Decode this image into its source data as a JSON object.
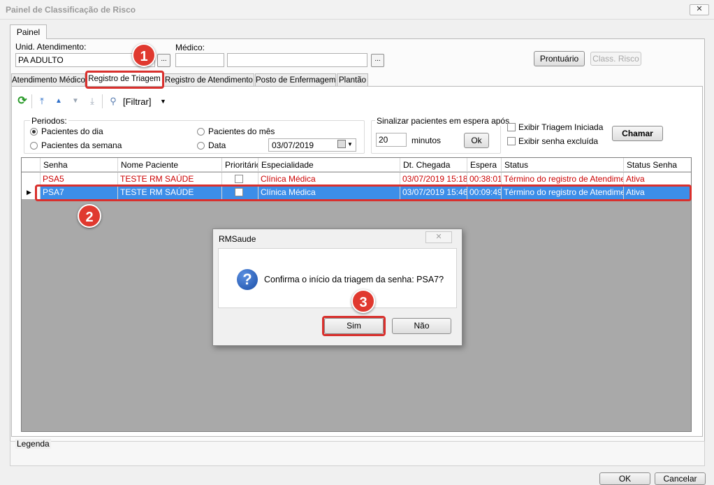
{
  "window": {
    "title": "Painel de Classificação de Risco",
    "close_glyph": "✕"
  },
  "top_tab": {
    "label": "Painel"
  },
  "form": {
    "unid_label": "Unid. Atendimento:",
    "unid_value": "PA ADULTO",
    "medico_label": "Médico:",
    "medico_code": "",
    "medico_name": "",
    "lookup_glyph": "..."
  },
  "buttons": {
    "prontuario": "Prontuário",
    "class_risco": "Class. Risco",
    "chamar": "Chamar",
    "ok_small": "Ok"
  },
  "subtabs": [
    {
      "label": "Atendimento Médico"
    },
    {
      "label": "Registro de Triagem"
    },
    {
      "label": "Registro de Atendimento"
    },
    {
      "label": "Posto de Enfermagem"
    },
    {
      "label": "Plantão"
    }
  ],
  "toolbar": {
    "filter_label": "[Filtrar]"
  },
  "periods": {
    "label": "Periodos:",
    "options": [
      "Pacientes do dia",
      "Pacientes da semana",
      "Pacientes do mês",
      "Data"
    ],
    "selected": "Pacientes do dia",
    "date_value": "03/07/2019"
  },
  "signal": {
    "label": "Sinalizar pacientes em espera após",
    "minutes_value": "20",
    "minutes_label": "minutos"
  },
  "checks": {
    "triagem_iniciada": "Exibir Triagem Iniciada",
    "senha_excluida": "Exibir senha excluída"
  },
  "grid": {
    "columns": [
      "Senha",
      "Nome Paciente",
      "Prioritário",
      "Especialidade",
      "Dt. Chegada",
      "Espera",
      "Status",
      "Status Senha"
    ],
    "rows": [
      {
        "senha": "PSA5",
        "nome": "TESTE RM SAÚDE",
        "especialidade": "Clínica Médica",
        "chegada": "03/07/2019 15:18",
        "espera": "00:38:01",
        "status": "Término do registro de Atendimento",
        "status_senha": "Ativa"
      },
      {
        "senha": "PSA7",
        "nome": "TESTE RM SAÚDE",
        "especialidade": "Clínica Médica",
        "chegada": "03/07/2019 15:46",
        "espera": "00:09:49",
        "status": "Término do registro de Atendimento",
        "status_senha": "Ativa"
      }
    ]
  },
  "dialog": {
    "title": "RMSaude",
    "message": "Confirma o início da triagem da senha: PSA7?",
    "yes": "Sim",
    "no": "Não"
  },
  "legend": {
    "label": "Legenda"
  },
  "footer": {
    "ok": "OK",
    "cancel": "Cancelar"
  },
  "annotations": {
    "badge1": "1",
    "badge2": "2",
    "badge3": "3"
  },
  "colors": {
    "selected_row": "#3d8ee8",
    "alert_text": "#cc0000",
    "annotation": "#e0392f"
  }
}
